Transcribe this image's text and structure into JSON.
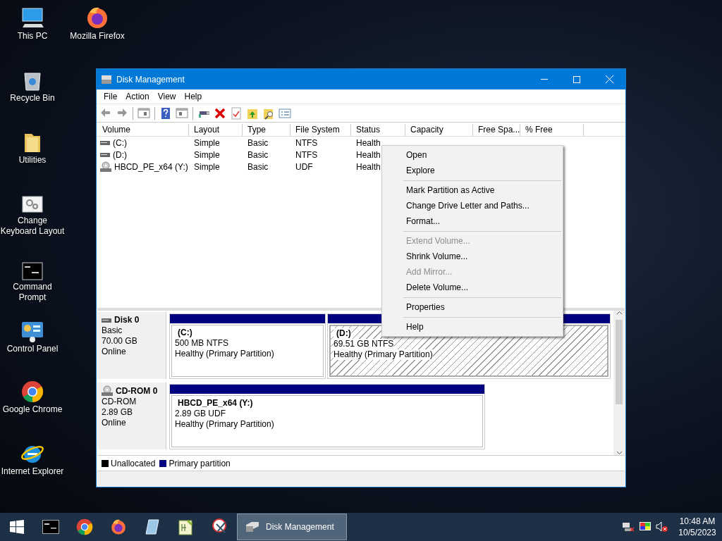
{
  "desktop_icons": [
    {
      "label": "This PC"
    },
    {
      "label": "Mozilla Firefox"
    },
    {
      "label": "Recycle Bin"
    },
    {
      "label": "Utilities"
    },
    {
      "label": "Change Keyboard Layout"
    },
    {
      "label": "Command Prompt"
    },
    {
      "label": "Control Panel"
    },
    {
      "label": "Google Chrome"
    },
    {
      "label": "Internet Explorer"
    }
  ],
  "window": {
    "title": "Disk Management",
    "menu": [
      "File",
      "Action",
      "View",
      "Help"
    ],
    "columns": [
      "Volume",
      "Layout",
      "Type",
      "File System",
      "Status",
      "Capacity",
      "Free Spa...",
      "% Free"
    ],
    "rows": [
      {
        "kind": "disk",
        "cells": [
          "(C:)",
          "Simple",
          "Basic",
          "NTFS",
          "Health"
        ]
      },
      {
        "kind": "disk",
        "cells": [
          "(D:)",
          "Simple",
          "Basic",
          "NTFS",
          "Health"
        ]
      },
      {
        "kind": "cd",
        "cells": [
          "HBCD_PE_x64 (Y:)",
          "Simple",
          "Basic",
          "UDF",
          "Health"
        ]
      }
    ],
    "disks": [
      {
        "kind": "disk",
        "name": "Disk 0",
        "type": "Basic",
        "size": "70.00 GB",
        "state": "Online",
        "partitions": [
          {
            "name": "(C:)",
            "detail": "500 MB NTFS",
            "status": "Healthy (Primary Partition)",
            "selected": false
          },
          {
            "name": "(D:)",
            "detail": "69.51 GB NTFS",
            "status": "Healthy (Primary Partition)",
            "selected": true
          }
        ]
      },
      {
        "kind": "cd",
        "name": "CD-ROM 0",
        "type": "CD-ROM",
        "size": "2.89 GB",
        "state": "Online",
        "partitions": [
          {
            "name": "HBCD_PE_x64  (Y:)",
            "detail": "2.89 GB UDF",
            "status": "Healthy (Primary Partition)",
            "selected": false
          }
        ]
      }
    ],
    "legend": [
      {
        "label": "Unallocated",
        "color": "#000000"
      },
      {
        "label": "Primary partition",
        "color": "#000080"
      }
    ]
  },
  "context_menu": [
    {
      "label": "Open",
      "disabled": false,
      "separator_before": false
    },
    {
      "label": "Explore",
      "disabled": false,
      "separator_before": false
    },
    {
      "label": "Mark Partition as Active",
      "disabled": false,
      "separator_before": true
    },
    {
      "label": "Change Drive Letter and Paths...",
      "disabled": false,
      "separator_before": false
    },
    {
      "label": "Format...",
      "disabled": false,
      "separator_before": false
    },
    {
      "label": "Extend Volume...",
      "disabled": true,
      "separator_before": true
    },
    {
      "label": "Shrink Volume...",
      "disabled": false,
      "separator_before": false
    },
    {
      "label": "Add Mirror...",
      "disabled": true,
      "separator_before": false
    },
    {
      "label": "Delete Volume...",
      "disabled": false,
      "separator_before": false
    },
    {
      "label": "Properties",
      "disabled": false,
      "separator_before": true
    },
    {
      "label": "Help",
      "disabled": false,
      "separator_before": true
    }
  ],
  "taskbar": {
    "apps": [
      {
        "label": "Disk Management",
        "selected": true
      }
    ],
    "time": "10:48 AM",
    "date": "10/5/2023"
  }
}
